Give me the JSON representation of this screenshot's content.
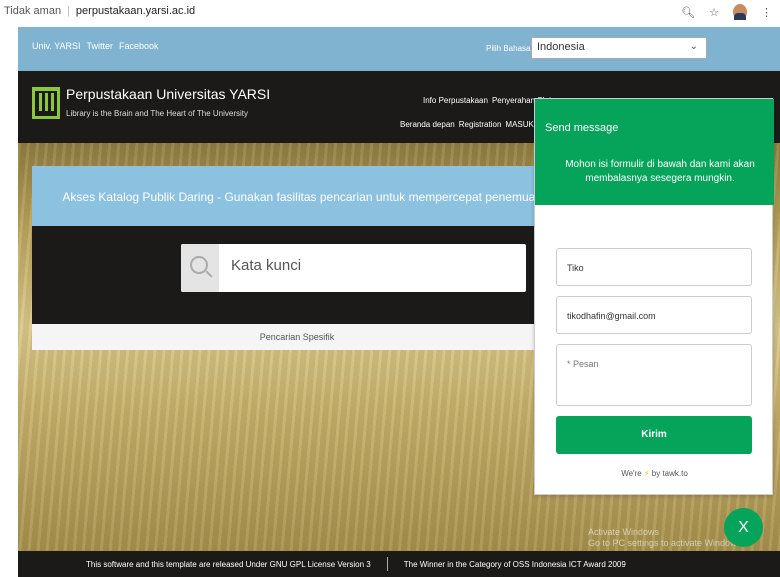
{
  "browser": {
    "security": "Tidak aman",
    "url": "perpustakaan.yarsi.ac.id"
  },
  "topbar": {
    "links": [
      "Univ. YARSI",
      "Twitter",
      "Facebook"
    ],
    "language_label": "Pilih Bahasa",
    "language_value": "Indonesia"
  },
  "brand": {
    "title": "Perpustakaan Universitas YARSI",
    "subtitle": "Library is the Brain and The Heart of The University"
  },
  "nav": {
    "row1": [
      "Info Perpustakaan",
      "Penyerahan Skrip"
    ],
    "row2": [
      "Beranda depan",
      "Registration",
      "MASUK Pust"
    ]
  },
  "catalog": {
    "banner": "Akses Katalog Publik Daring - Gunakan fasilitas pencarian untuk mempercepat penemuan d",
    "search_placeholder": "Kata kunci",
    "specific_search": "Pencarian Spesifik"
  },
  "footer": {
    "license": "This software and this template are released Under GNU GPL License Version 3",
    "award": "The Winner in the Category of OSS Indonesia ICT Award 2009"
  },
  "chat_widget": {
    "title": "Send message",
    "subtitle": "Mohon isi formulir di bawah dan kami akan membalasnya sesegera mungkin.",
    "name_value": "Tiko",
    "email_value": "tikodhafin@gmail.com",
    "message_placeholder": "* Pesan",
    "send_label": "Kirim",
    "powered_prefix": "We're",
    "powered_suffix": "by tawk.to",
    "close_label": "X"
  },
  "watermark": {
    "line1": "Activate Windows",
    "line2": "Go to PC settings to activate Windows"
  },
  "colors": {
    "accent": "#06a35a",
    "topbar": "#7fb3d0",
    "dark": "#1b1a18"
  }
}
